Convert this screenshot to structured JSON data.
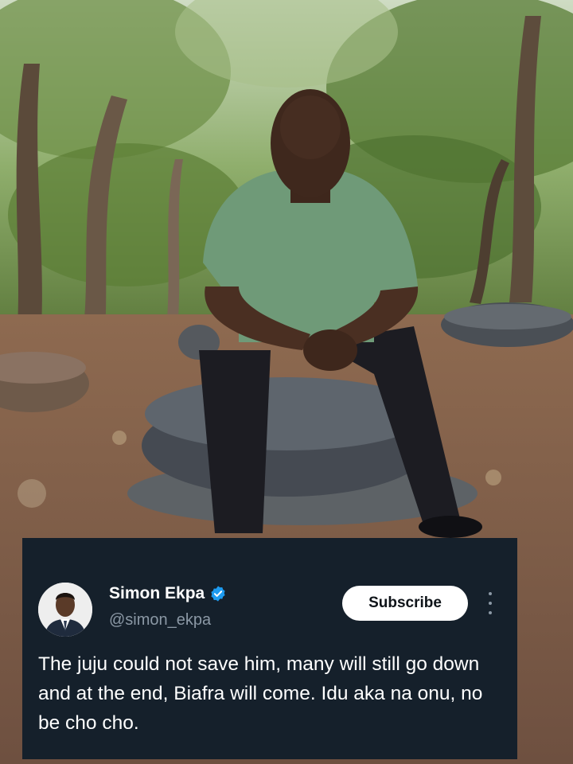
{
  "tweet": {
    "display_name": "Simon Ekpa",
    "handle": "@simon_ekpa",
    "verified_icon": "verified-badge-icon",
    "subscribe_label": "Subscribe",
    "more_icon": "more-vertical-icon",
    "text": "The juju could not save him, many will still go down and at the end, Biafra will come. Idu aka na onu, no be cho cho."
  },
  "colors": {
    "card_background": "#15202b",
    "handle_gray": "#8b98a5",
    "verified_blue": "#1d9bf0"
  }
}
